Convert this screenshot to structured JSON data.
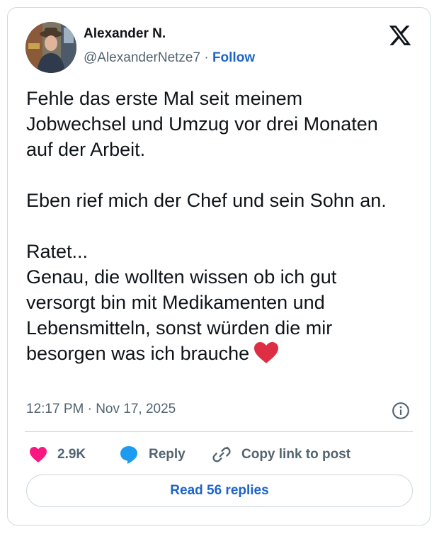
{
  "author": {
    "name": "Alexander N.",
    "handle": "@AlexanderNetze7",
    "separator": "·",
    "follow_label": "Follow"
  },
  "tweet": {
    "paragraphs": [
      "Fehle das erste Mal seit meinem Jobwechsel und Umzug vor drei Monaten auf der Arbeit.",
      "Eben rief mich der Chef und sein Sohn an.",
      "Ratet...\nGenau, die wollten wissen ob ich gut versorgt bin mit Medikamenten und Lebensmitteln, sonst würden die mir besorgen was ich brauche"
    ],
    "emoji": "heart-emoji",
    "timestamp": "12:17 PM · Nov 17, 2025"
  },
  "actions": {
    "like_count": "2.9K",
    "reply_label": "Reply",
    "copy_label": "Copy link to post"
  },
  "footer": {
    "read_replies_label": "Read 56 replies"
  },
  "colors": {
    "like": "#f91880",
    "reply_icon": "#1d9bf0",
    "follow": "#1d64c8",
    "heart_emoji": "#dd2e44",
    "muted": "#536471",
    "border": "#cfd9de"
  }
}
